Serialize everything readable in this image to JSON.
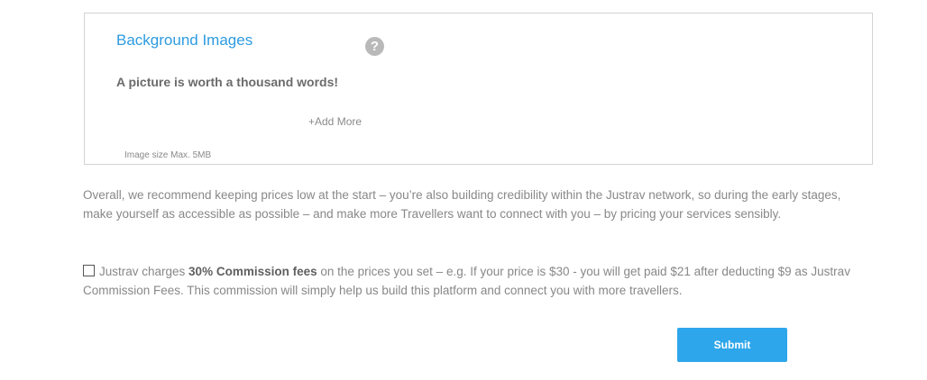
{
  "background_section": {
    "title": "Background Images",
    "help_icon": "?",
    "tagline": "A picture is worth a thousand words!",
    "add_more_label": "+Add More",
    "image_size_note": "Image size Max. 5MB"
  },
  "recommendation_text": "Overall, we recommend keeping prices low at the start – you’re also building credibility within the Justrav network, so during the early stages, make yourself as accessible as possible – and make more Travellers want to connect with you – by pricing your services sensibly.",
  "commission": {
    "prefix": "Justrav charges ",
    "bold": "30% Commission fees",
    "suffix": " on the prices you set – e.g. If your price is $30 - you will get paid $21 after deducting $9 as Justrav Commission Fees. This commission will simply help us build this platform and connect you with more travellers.",
    "checked": false
  },
  "submit_label": "Submit",
  "colors": {
    "accent": "#2d9be0",
    "button": "#2ea6eb",
    "text": "#888888",
    "border": "#d3d3d3"
  }
}
